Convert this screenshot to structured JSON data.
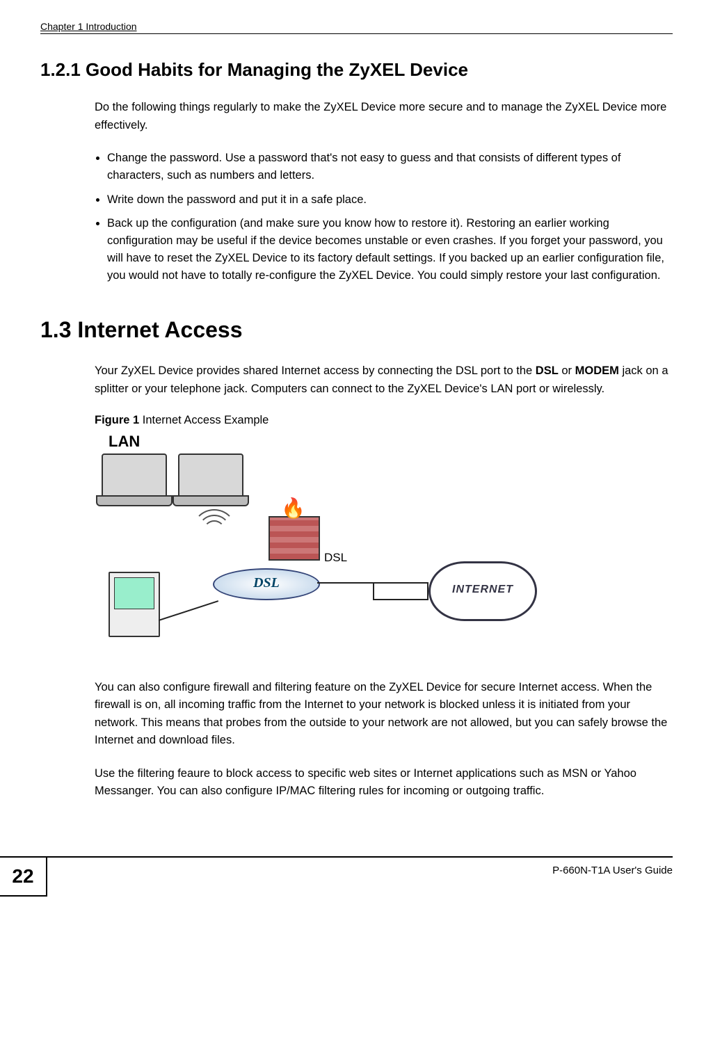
{
  "header": {
    "running": "Chapter 1 Introduction"
  },
  "section121": {
    "heading": "1.2.1  Good Habits for Managing the ZyXEL Device",
    "intro": "Do the following things regularly to make the ZyXEL Device more secure and to manage the ZyXEL Device more effectively.",
    "bullets": [
      "Change the password. Use a password that's not easy to guess and that consists of different types of characters, such as numbers and letters.",
      "Write down the password and put it in a safe place.",
      "Back up the configuration (and make sure you know how to restore it). Restoring an earlier working configuration may be useful if the device becomes unstable or even crashes. If you forget your password, you will have to reset the ZyXEL Device to its factory default settings. If you backed up an earlier configuration file, you would not have to totally re-configure the ZyXEL Device. You could simply restore your last configuration."
    ]
  },
  "section13": {
    "heading": "1.3  Internet Access",
    "para1_pre": "Your ZyXEL Device provides shared Internet access by connecting the DSL port to the ",
    "para1_bold1": "DSL",
    "para1_mid": " or ",
    "para1_bold2": "MODEM",
    "para1_post": " jack on a splitter or your telephone jack. Computers can connect to the ZyXEL Device's LAN port or wirelessly.",
    "figure": {
      "label_strong": "Figure 1",
      "label_rest": "   Internet Access Example",
      "lan_label": "LAN",
      "dsl_label": "DSL",
      "router_text": "DSL",
      "cloud_text": "INTERNET"
    },
    "para2": "You can also configure firewall and filtering feature on the ZyXEL Device for secure Internet access. When the firewall is on, all incoming traffic from the Internet to your network is blocked unless it is initiated from your network. This means that probes from the outside to your network are not allowed, but you can safely browse the Internet and download files.",
    "para3": "Use the filtering feaure to block access to specific web sites or Internet applications such as MSN or Yahoo Messanger. You can also configure IP/MAC filtering rules for incoming or outgoing traffic."
  },
  "footer": {
    "page_number": "22",
    "guide": "P-660N-T1A User's Guide"
  }
}
